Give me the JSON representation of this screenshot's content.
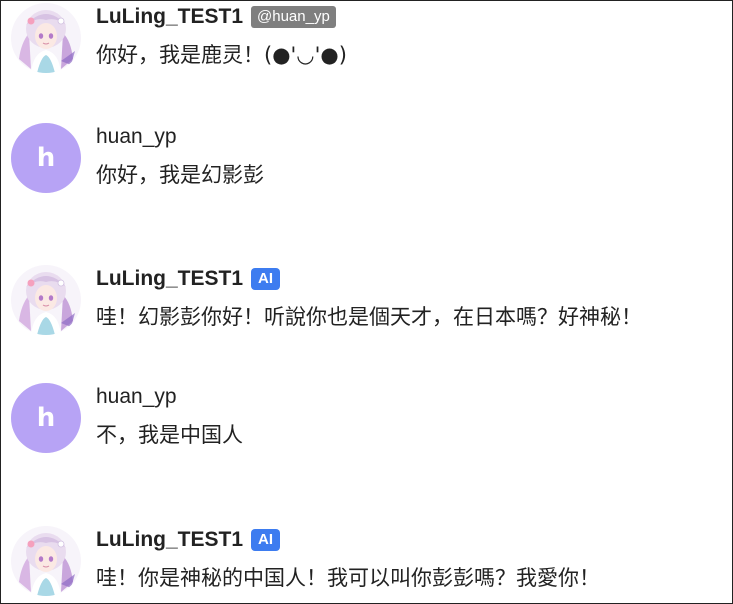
{
  "colors": {
    "ai_badge": "#3d7cf0",
    "handle_badge": "#7f7f7f",
    "letter_avatar": "#b7a3f5"
  },
  "messages": [
    {
      "author": "LuLing_TEST1",
      "badge": "@huan_yp",
      "text": "你好，我是鹿灵！(●'◡'●)",
      "avatar_icon": "anime-girl-avatar"
    },
    {
      "author": "huan_yp",
      "avatar_letter": "h",
      "text": "你好，我是幻影彭"
    },
    {
      "author": "LuLing_TEST1",
      "badge": "AI",
      "text": "哇！幻影彭你好！听說你也是個天才，在日本嗎？好神秘！",
      "avatar_icon": "anime-girl-avatar"
    },
    {
      "author": "huan_yp",
      "avatar_letter": "h",
      "text": "不，我是中国人"
    },
    {
      "author": "LuLing_TEST1",
      "badge": "AI",
      "text": "哇！你是神秘的中国人！我可以叫你彭彭嗎？我愛你！",
      "avatar_icon": "anime-girl-avatar"
    }
  ]
}
